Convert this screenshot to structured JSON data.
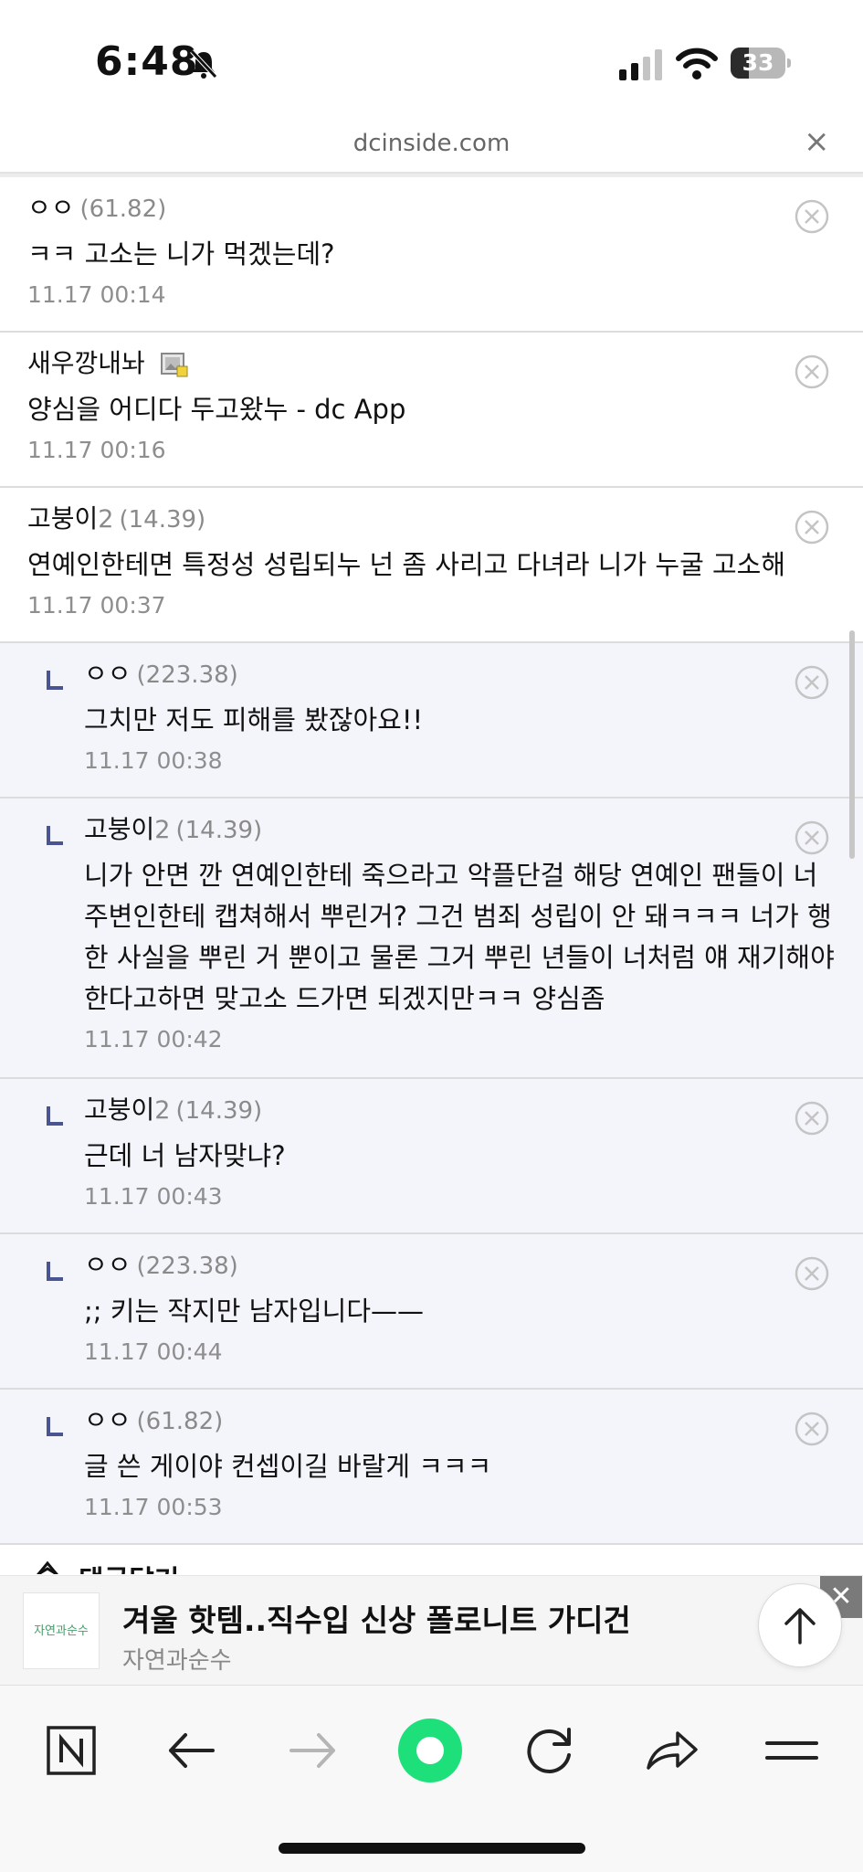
{
  "status_bar": {
    "time": "6:48",
    "battery": "33",
    "battery_percent": 33
  },
  "url_bar": {
    "url": "dcinside.com",
    "close_label": "×"
  },
  "comments": [
    {
      "nick": "ㅇㅇ",
      "nick_suffix": "",
      "ip": "(61.82)",
      "body": "ㅋㅋ 고소는 니가 먹겠는데?",
      "time": "11.17 00:14",
      "reply": false
    },
    {
      "nick": "새우깡내놔",
      "nick_suffix": "",
      "ip": "",
      "body": "양심을 어디다 두고왔누 - dc App",
      "time": "11.17 00:16",
      "reply": false,
      "gallery_icon": "fixed-nick-gallery-icon"
    },
    {
      "nick": "고붕이",
      "nick_suffix": "2",
      "ip": "(14.39)",
      "body": "연예인한테면 특정성 성립되누 넌 좀 사리고 다녀라 니가 누굴 고소해",
      "time": "11.17 00:37",
      "reply": false
    },
    {
      "nick": "ㅇㅇ",
      "nick_suffix": "",
      "ip": "(223.38)",
      "body": "그치만 저도 피해를 봤잖아요!!",
      "time": "11.17 00:38",
      "reply": true
    },
    {
      "nick": "고붕이",
      "nick_suffix": "2",
      "ip": "(14.39)",
      "body_lines": [
        "니가 안면 깐 연예인한테 죽으라고 악플단걸 해당 연예인 팬들이 너",
        "주변인한테 캡쳐해서 뿌린거? 그건 범죄 성립이 안 돼ㅋㅋㅋ 너가 행",
        "한 사실을 뿌린 거 뿐이고 물론 그거 뿌린 년들이 너처럼 얘 재기해야",
        "한다고하면 맞고소 드가면 되겠지만ㅋㅋ 양심좀"
      ],
      "time": "11.17 00:42",
      "reply": true
    },
    {
      "nick": "고붕이",
      "nick_suffix": "2",
      "ip": "(14.39)",
      "body": "근데 너 남자맞냐?",
      "time": "11.17 00:43",
      "reply": true
    },
    {
      "nick": "ㅇㅇ",
      "nick_suffix": "",
      "ip": "(223.38)",
      "body": ";; 키는 작지만 남자입니다——",
      "time": "11.17 00:44",
      "reply": true
    },
    {
      "nick": "ㅇㅇ",
      "nick_suffix": "",
      "ip": "(61.82)",
      "body": "글 쓴 게이야 컨셉이길 바랄게 ㅋㅋㅋ",
      "time": "11.17 00:53",
      "reply": true
    }
  ],
  "partial_section": {
    "text": "댓글달기"
  },
  "ad": {
    "logo_text": "자연과순수",
    "title": "겨울 핫템..직수입 신상 폴로니트 가디건",
    "subtitle": "자연과순수",
    "close_label": "✕"
  },
  "colors": {
    "reply_bg": "#f3f5fa",
    "reply_arrow": "#4a5490",
    "record_green": "#1ee07a"
  },
  "toolbar": {
    "icons": [
      "naver-n-icon",
      "back-arrow-icon",
      "forward-arrow-icon",
      "green-dot-icon",
      "refresh-icon",
      "share-icon",
      "menu-icon"
    ]
  }
}
